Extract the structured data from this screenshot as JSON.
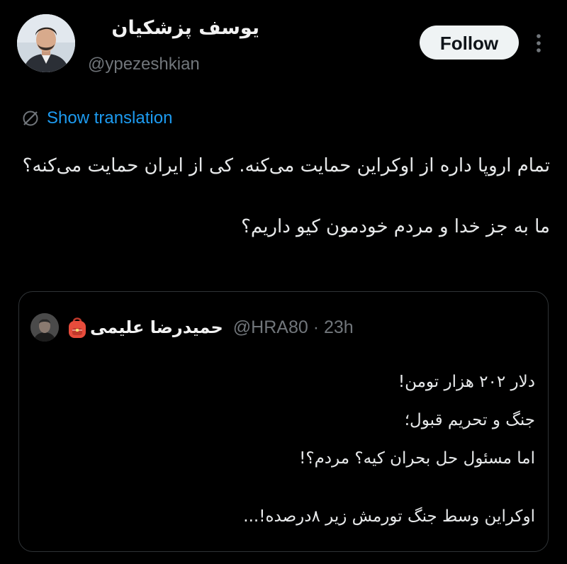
{
  "tweet": {
    "author_name": "یوسف پزشکیان",
    "author_handle": "@ypezeshkian",
    "follow_label": "Follow",
    "show_translation_label": "Show translation",
    "text_paragraph_1": "تمام اروپا داره از اوکراین حمایت می‌کنه. کی از ایران حمایت می‌کنه؟",
    "text_paragraph_2": "ما به جز خدا و مردم خودمون کیو داریم؟"
  },
  "quoted_tweet": {
    "author_name": "حمیدرضا علیمی",
    "handle_and_time": "@HRA80 · 23h",
    "lines": [
      "دلار ۲۰۲ هزار تومن!",
      "جنگ و تحریم قبول؛",
      "اما مسئول حل بحران کیه؟ مردم؟!",
      "اوکراین وسط جنگ تورمش زیر ۸درصده!..."
    ]
  },
  "colors": {
    "background": "#000000",
    "link_blue": "#1d9bf0",
    "muted_gray": "#71767b",
    "text": "#e7e9ea",
    "follow_bg": "#eff3f4",
    "border": "#2f3336"
  },
  "icons": [
    "avatar",
    "more-options-icon",
    "translate-globe-icon",
    "backpack-emoji-icon"
  ]
}
